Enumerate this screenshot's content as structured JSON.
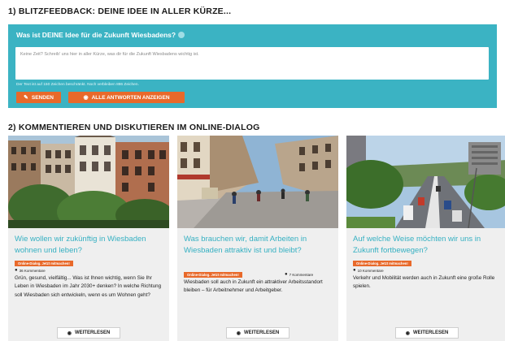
{
  "section1": {
    "title": "1) BLITZFEEDBACK: DEINE IDEE IN ALLER KÜRZE...",
    "question": "Was ist DEINE Idee für die Zukunft Wiesbadens?",
    "textarea_placeholder": "Keine Zeit? Schreib' uns hier in aller Kürze, was dir für die Zukunft Wiesbadens wichtig ist.",
    "hint": "Der Text ist auf 150 Zeichen beschränkt. Noch verbleiben 886 Zeichen.",
    "send_label": "SENDEN",
    "send_icon": "pencil-icon",
    "answers_label": "ALLE ANTWORTEN ANZEIGEN",
    "answers_icon": "eye-icon"
  },
  "section2": {
    "title": "2) KOMMENTIEREN UND DISKUTIEREN IM ONLINE-DIALOG"
  },
  "cards": [
    {
      "title": "Wie wollen wir zukünftig in Wiesbaden wohnen und leben?",
      "badge": "Online-Dialog. Jetzt mitmachen!",
      "comments": "36 Kommentare",
      "text": "Grün, gesund, vielfältig... Was ist Ihnen wichtig, wenn Sie Ihr Leben in Wiesbaden im Jahr 2030+ denken? In welche Richtung soll Wiesbaden sich entwickeln, wenn es um Wohnen geht?",
      "more": "WEITERLESEN"
    },
    {
      "title": "Was brauchen wir, damit Arbeiten in Wiesbaden attraktiv ist und bleibt?",
      "badge": "Online-Dialog. Jetzt mitmachen!",
      "comments": "7 Kommentare",
      "text": "Wiesbaden soll auch in Zukunft ein attraktiver Arbeitsstandort bleiben – für Arbeitnehmer und Arbeitgeber.",
      "more": "WEITERLESEN"
    },
    {
      "title": "Auf welche Weise möchten wir uns in Zukunft fortbewegen?",
      "badge": "Online-Dialog. Jetzt mitmachen!",
      "comments": "10 Kommentare",
      "text": "Verkehr und Mobilität werden auch in Zukunft eine große Rolle spielen.",
      "more": "WEITERLESEN"
    }
  ],
  "icons": {
    "comment": "speech-bubble-icon",
    "more": "eye-icon"
  },
  "colors": {
    "teal": "#3bb3c3",
    "orange": "#e8692a",
    "card_bg": "#efefef"
  }
}
